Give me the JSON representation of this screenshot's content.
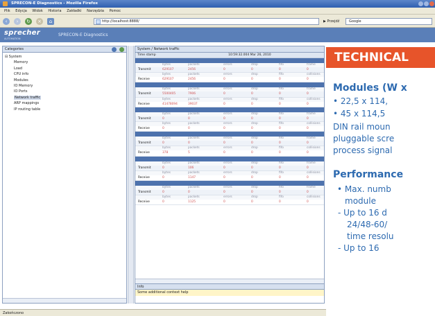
{
  "window": {
    "title": "SPRECON-E Diagnostics - Mozilla Firefox"
  },
  "menu": [
    "Plik",
    "Edycja",
    "Widok",
    "Historia",
    "Zakładki",
    "Narzędzia",
    "Pomoc"
  ],
  "nav": {
    "url": "http://localhost:8888/",
    "search_label": "Przejdź",
    "search_engine": "Google"
  },
  "app": {
    "logo": "sprecher",
    "logo_sub": "AUTOMATION",
    "name": "SPRECON-E Diagnostics"
  },
  "left": {
    "title": "Categories",
    "tree": [
      {
        "label": "System",
        "indent": 0,
        "prefix": "⊟ "
      },
      {
        "label": "Memory",
        "indent": 1
      },
      {
        "label": "Load",
        "indent": 1
      },
      {
        "label": "CPU info",
        "indent": 1
      },
      {
        "label": "Modules",
        "indent": 1
      },
      {
        "label": "IO Memory",
        "indent": 1
      },
      {
        "label": "IO Ports",
        "indent": 1
      },
      {
        "label": "Network traffic",
        "indent": 1,
        "selected": true
      },
      {
        "label": "ARP mappings",
        "indent": 1
      },
      {
        "label": "IP routing table",
        "indent": 1
      }
    ]
  },
  "right": {
    "title": "System / Network traffic",
    "timestamp_label": "Time stamp",
    "timestamp_value": "10:59:32.004 Mar 26, 2010",
    "columns": [
      "bytes",
      "packets",
      "errors",
      "drop",
      "fifo",
      "frame"
    ],
    "tx_columns": [
      "bytes",
      "packets",
      "errors",
      "drop",
      "fifo",
      "collisions"
    ],
    "interfaces": [
      {
        "receive": [
          "629107",
          "2456",
          "0",
          "0",
          "0",
          "0"
        ],
        "transmit": [
          "629107",
          "2456",
          "0",
          "0",
          "0",
          "0"
        ]
      },
      {
        "receive": [
          "5500405",
          "7906",
          "0",
          "0",
          "0",
          "0"
        ],
        "transmit": [
          "41478094",
          "39037",
          "0",
          "0",
          "0",
          "0"
        ]
      },
      {
        "receive": [
          "0",
          "0",
          "0",
          "0",
          "0",
          "0"
        ],
        "transmit": [
          "0",
          "0",
          "0",
          "0",
          "0",
          "0"
        ]
      },
      {
        "receive": [
          "0",
          "0",
          "0",
          "0",
          "0",
          "0"
        ],
        "transmit": [
          "378",
          "5",
          "0",
          "0",
          "0",
          "0"
        ]
      },
      {
        "receive": [
          "0",
          "106",
          "0",
          "0",
          "0",
          "0"
        ],
        "transmit": [
          "0",
          "1147",
          "0",
          "0",
          "0",
          "0"
        ]
      },
      {
        "receive": [
          "0",
          "0",
          "0",
          "0",
          "0",
          "0"
        ],
        "transmit": [
          "0",
          "1125",
          "0",
          "0",
          "0",
          "0"
        ]
      }
    ],
    "row_labels": {
      "transmit": "Transmit",
      "receive": "Receive"
    },
    "info_title": "Info",
    "info_help": "Some additional context help"
  },
  "status": {
    "text": "Zakończono"
  },
  "overlay": {
    "heading": "TECHNICAL",
    "modules_title": "Modules (W x",
    "bullets": [
      "• 22,5 x 114,",
      "• 45 x 114,5"
    ],
    "desc": [
      "DIN rail moun",
      "pluggable scre",
      "process signal"
    ],
    "perf_title": "Performance",
    "perf": [
      "• Max. numb",
      "module",
      "- Up to 16 d",
      "24/48-60/",
      "time resolu",
      "- Up to 16"
    ]
  },
  "colors": {
    "accent": "#e7542a",
    "overlay_text": "#2d6ab0",
    "header": "#5a7fb8",
    "iface_bar": "#4d72ad"
  }
}
